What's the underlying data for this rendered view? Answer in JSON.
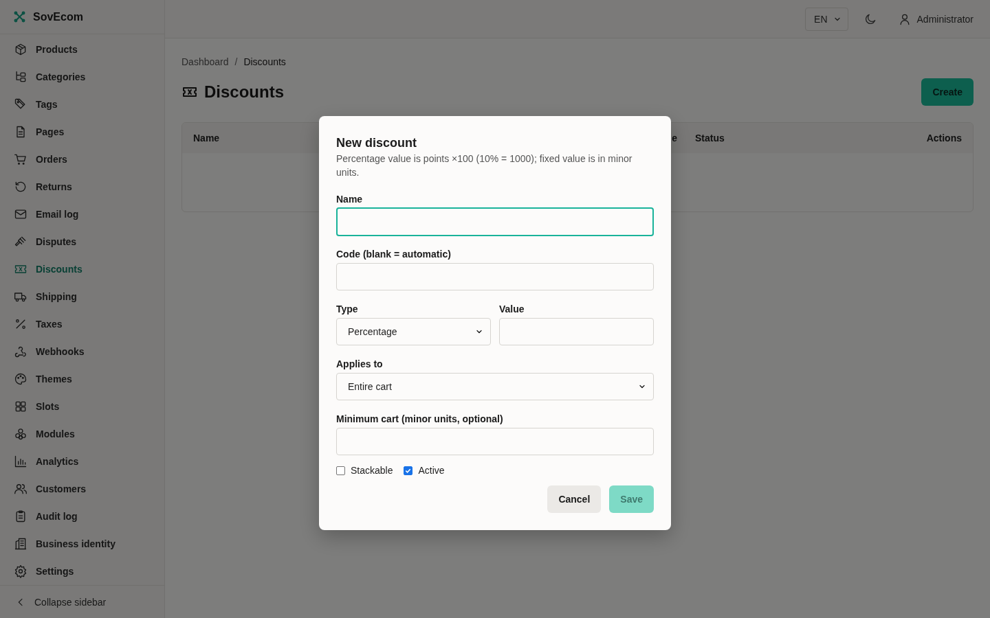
{
  "brand": {
    "name": "SovEcom"
  },
  "sidebar": {
    "items": [
      {
        "label": "Products",
        "selected": false
      },
      {
        "label": "Categories",
        "selected": false
      },
      {
        "label": "Tags",
        "selected": false
      },
      {
        "label": "Pages",
        "selected": false
      },
      {
        "label": "Orders",
        "selected": false
      },
      {
        "label": "Returns",
        "selected": false
      },
      {
        "label": "Email log",
        "selected": false
      },
      {
        "label": "Disputes",
        "selected": false
      },
      {
        "label": "Discounts",
        "selected": true
      },
      {
        "label": "Shipping",
        "selected": false
      },
      {
        "label": "Taxes",
        "selected": false
      },
      {
        "label": "Webhooks",
        "selected": false
      },
      {
        "label": "Themes",
        "selected": false
      },
      {
        "label": "Slots",
        "selected": false
      },
      {
        "label": "Modules",
        "selected": false
      },
      {
        "label": "Analytics",
        "selected": false
      },
      {
        "label": "Customers",
        "selected": false
      },
      {
        "label": "Audit log",
        "selected": false
      },
      {
        "label": "Business identity",
        "selected": false
      },
      {
        "label": "Settings",
        "selected": false
      }
    ],
    "collapse": "Collapse sidebar"
  },
  "topbar": {
    "language": "EN",
    "user": "Administrator"
  },
  "breadcrumb": {
    "items": [
      "Dashboard",
      "Discounts"
    ],
    "separator": "/"
  },
  "page": {
    "title": "Discounts",
    "create_button": "Create"
  },
  "table": {
    "columns": [
      "Name",
      "e",
      "Status",
      "Actions"
    ]
  },
  "dialog": {
    "title": "New discount",
    "description": "Percentage value is points ×100 (10% = 1000); fixed value is in minor units.",
    "rows": [
      [
        {
          "kind": "text",
          "label": "Name",
          "focused": true
        }
      ],
      [
        {
          "kind": "text",
          "label": "Code (blank = automatic)",
          "focused": false
        }
      ],
      [
        {
          "kind": "select",
          "label": "Type",
          "value": "Percentage",
          "focused": false
        },
        {
          "kind": "text",
          "label": "Value",
          "focused": false
        }
      ],
      [
        {
          "kind": "select",
          "label": "Applies to",
          "value": "Entire cart",
          "focused": false
        }
      ],
      [
        {
          "kind": "text",
          "label": "Minimum cart (minor units, optional)",
          "focused": false
        }
      ]
    ],
    "checkboxes": [
      {
        "label": "Stackable",
        "checked": false
      },
      {
        "label": "Active",
        "checked": true
      }
    ],
    "buttons": [
      {
        "label": "Cancel",
        "kind": "secondary",
        "disabled": false
      },
      {
        "label": "Save",
        "kind": "primary",
        "disabled": true
      }
    ]
  }
}
